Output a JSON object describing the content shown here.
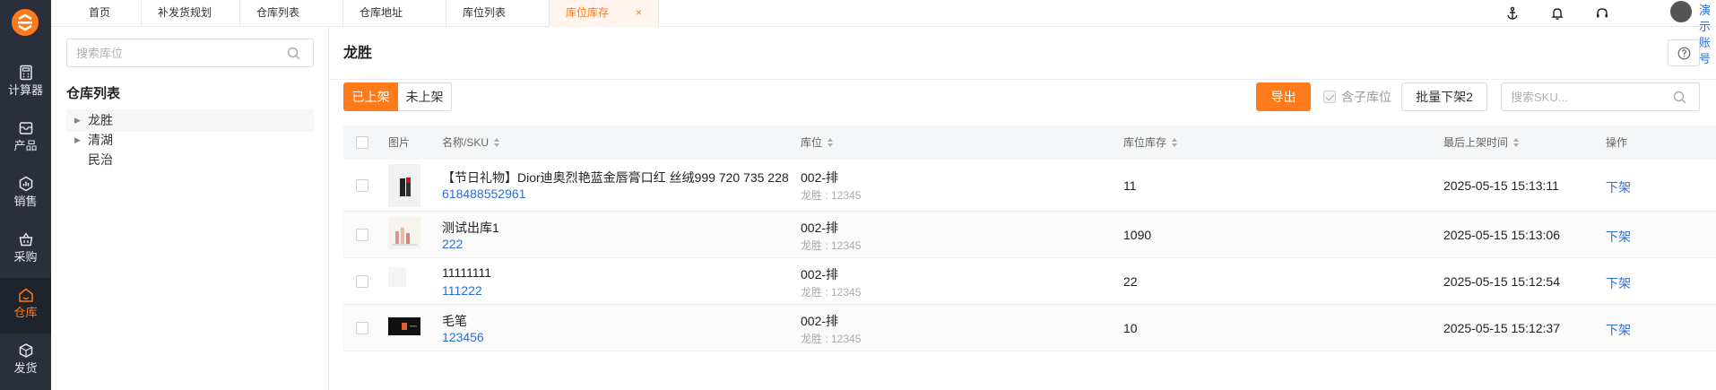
{
  "nav": {
    "items": [
      {
        "label": "计算器",
        "icon": "calculator-icon"
      },
      {
        "label": "产品",
        "icon": "box-icon"
      },
      {
        "label": "销售",
        "icon": "sales-chart-icon"
      },
      {
        "label": "采购",
        "icon": "shopping-basket-icon"
      },
      {
        "label": "仓库",
        "icon": "warehouse-icon",
        "active": true
      },
      {
        "label": "发货",
        "icon": "shipping-icon"
      }
    ]
  },
  "tabs": [
    {
      "label": "首页"
    },
    {
      "label": "补发货规划"
    },
    {
      "label": "仓库列表"
    },
    {
      "label": "仓库地址"
    },
    {
      "label": "库位列表"
    },
    {
      "label": "库位库存",
      "active": true,
      "close": "×"
    }
  ],
  "header": {
    "account": "演示账号"
  },
  "tree": {
    "search_placeholder": "搜索库位",
    "title": "仓库列表",
    "nodes": [
      {
        "label": "龙胜",
        "expandable": true,
        "active": true
      },
      {
        "label": "清湖",
        "expandable": true
      },
      {
        "label": "民治",
        "expandable": false
      }
    ]
  },
  "main": {
    "title": "龙胜",
    "segments": {
      "on": "已上架",
      "off": "未上架"
    },
    "export_label": "导出",
    "include_sub_label": "含子库位",
    "batch_label": "批量下架2",
    "sku_placeholder": "搜索SKU..."
  },
  "table": {
    "columns": {
      "image": "图片",
      "name": "名称/SKU",
      "location": "库位",
      "stock": "库位库存",
      "time": "最后上架时间",
      "action": "操作"
    },
    "rows": [
      {
        "name": "【节日礼物】Dior迪奥烈艳蓝金唇膏口红 丝绒999 720 735 228",
        "sku": "618488552961",
        "location": "002-排",
        "location_sub": "龙胜 : 12345",
        "stock": "11",
        "time": "2025-05-15 15:13:11",
        "action": "下架"
      },
      {
        "name": "测试出库1",
        "sku": "222",
        "location": "002-排",
        "location_sub": "龙胜 : 12345",
        "stock": "1090",
        "time": "2025-05-15 15:13:06",
        "action": "下架"
      },
      {
        "name": "11111111",
        "sku": "111222",
        "location": "002-排",
        "location_sub": "龙胜 : 12345",
        "stock": "22",
        "time": "2025-05-15 15:12:54",
        "action": "下架"
      },
      {
        "name": "毛笔",
        "sku": "123456",
        "location": "002-排",
        "location_sub": "龙胜 : 12345",
        "stock": "10",
        "time": "2025-05-15 15:12:37",
        "action": "下架"
      }
    ]
  },
  "colors": {
    "accent": "#ff7a1a",
    "link": "#2b6fd6",
    "nav_bg": "#2a2f3b"
  }
}
